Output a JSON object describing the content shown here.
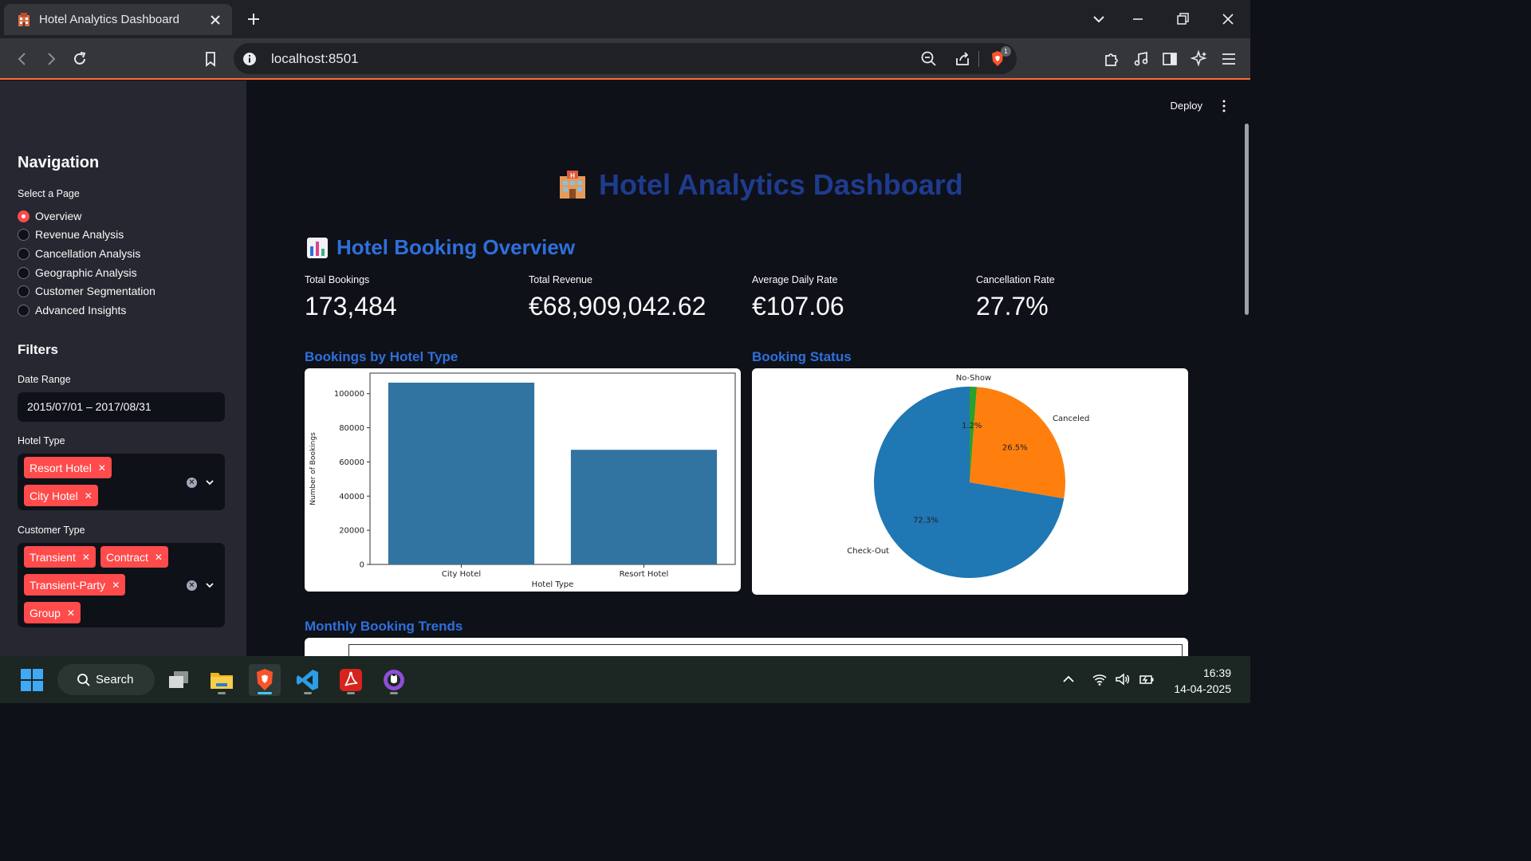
{
  "browser": {
    "tab_title": "Hotel Analytics Dashboard",
    "url": "localhost:8501",
    "shield_badge": "1"
  },
  "app": {
    "deploy_label": "Deploy",
    "title": "Hotel Analytics Dashboard",
    "overview_heading": "Hotel Booking Overview"
  },
  "sidebar": {
    "nav_heading": "Navigation",
    "select_label": "Select a Page",
    "pages": [
      {
        "label": "Overview",
        "selected": true
      },
      {
        "label": "Revenue Analysis",
        "selected": false
      },
      {
        "label": "Cancellation Analysis",
        "selected": false
      },
      {
        "label": "Geographic Analysis",
        "selected": false
      },
      {
        "label": "Customer Segmentation",
        "selected": false
      },
      {
        "label": "Advanced Insights",
        "selected": false
      }
    ],
    "filters_heading": "Filters",
    "date_label": "Date Range",
    "date_value": "2015/07/01 – 2017/08/31",
    "hotel_type_label": "Hotel Type",
    "hotel_types": [
      "Resort Hotel",
      "City Hotel"
    ],
    "customer_type_label": "Customer Type",
    "customer_types": [
      "Transient",
      "Contract",
      "Transient-Party",
      "Group"
    ]
  },
  "metrics": [
    {
      "label": "Total Bookings",
      "value": "173,484"
    },
    {
      "label": "Total Revenue",
      "value": "€68,909,042.62"
    },
    {
      "label": "Average Daily Rate",
      "value": "€107.06"
    },
    {
      "label": "Cancellation Rate",
      "value": "27.7%"
    }
  ],
  "charts": {
    "bar_heading": "Bookings by Hotel Type",
    "pie_heading": "Booking Status",
    "trend_heading": "Monthly Booking Trends"
  },
  "chart_data": [
    {
      "type": "bar",
      "categories": [
        "City Hotel",
        "Resort Hotel"
      ],
      "values": [
        106400,
        67100
      ],
      "xlabel": "Hotel Type",
      "ylabel": "Number of Bookings",
      "ylim": [
        0,
        112000
      ],
      "yticks": [
        "0",
        "20000",
        "40000",
        "60000",
        "80000",
        "100000"
      ],
      "color": "#3274a1"
    },
    {
      "type": "pie",
      "labels": [
        "Check-Out",
        "Canceled",
        "No-Show"
      ],
      "values": [
        72.3,
        26.5,
        1.2
      ],
      "pct_labels": [
        "72.3%",
        "26.5%",
        "1.2%"
      ],
      "colors": [
        "#1f77b4",
        "#ff7f0e",
        "#2ca02c"
      ]
    }
  ],
  "taskbar": {
    "search_label": "Search",
    "time": "16:39",
    "date": "14-04-2025"
  }
}
